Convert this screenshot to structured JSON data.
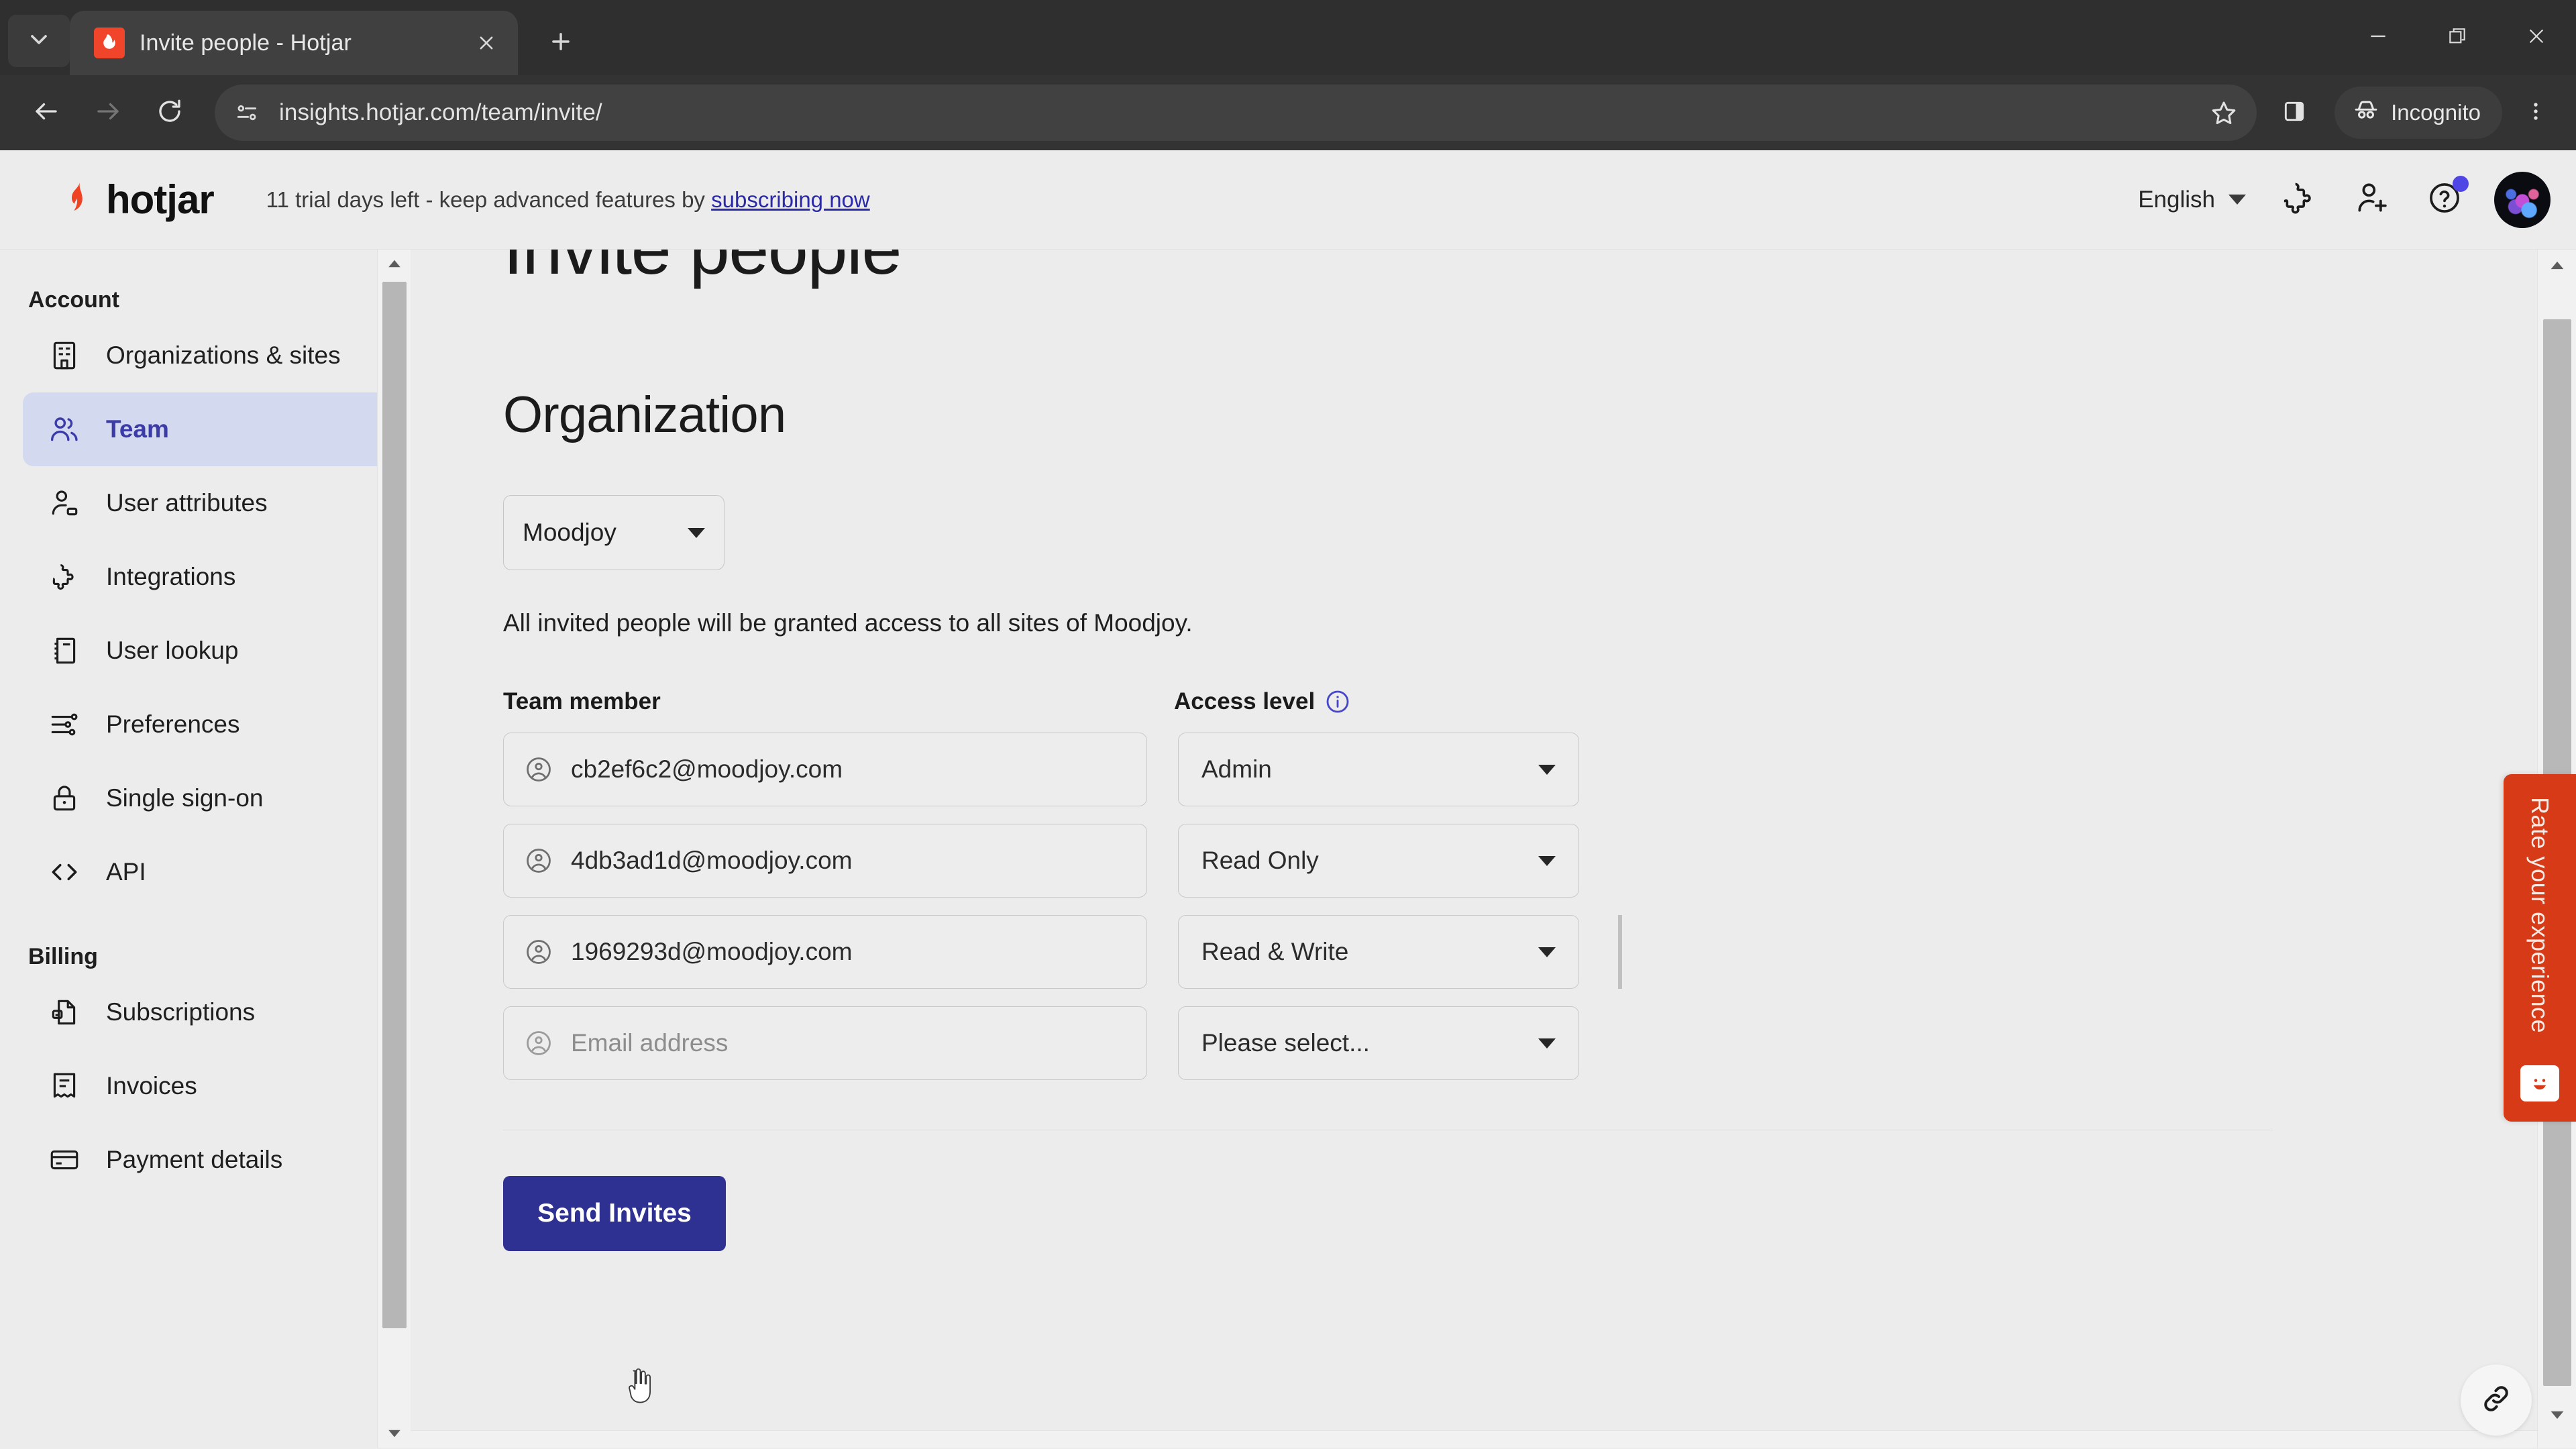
{
  "browser": {
    "tab": {
      "title": "Invite people - Hotjar",
      "favicon_icon": "hotjar-favicon",
      "close_icon": "close-icon"
    },
    "tab_list_icon": "chevron-down-icon",
    "new_tab_icon": "plus-icon",
    "window_controls": {
      "minimize_icon": "minimize-icon",
      "maximize_icon": "restore-icon",
      "close_icon": "close-icon"
    },
    "toolbar": {
      "back_icon": "arrow-left-icon",
      "forward_icon": "arrow-right-icon",
      "reload_icon": "reload-icon",
      "site_info_icon": "page-settings-icon",
      "url": "insights.hotjar.com/team/invite/",
      "bookmark_icon": "star-icon",
      "side_panel_icon": "side-panel-icon",
      "incognito_label": "Incognito",
      "incognito_icon": "incognito-icon",
      "menu_icon": "kebab-menu-icon"
    }
  },
  "app_header": {
    "logo_text": "hotjar",
    "logo_icon": "hotjar-flame-icon",
    "trial_prefix": "11 trial days left - keep advanced features by ",
    "trial_link": "subscribing now",
    "language": "English",
    "language_caret_icon": "chevron-down-icon",
    "integrations_icon": "puzzle-piece-icon",
    "invite_icon": "user-plus-icon",
    "help_icon": "question-circle-icon",
    "avatar_icon": "user-avatar"
  },
  "sidebar": {
    "groups": [
      {
        "title": "Account",
        "items": [
          {
            "label": "Organizations & sites",
            "icon": "building-icon",
            "active": false
          },
          {
            "label": "Team",
            "icon": "users-icon",
            "active": true
          },
          {
            "label": "User attributes",
            "icon": "user-tag-icon",
            "active": false
          },
          {
            "label": "Integrations",
            "icon": "puzzle-piece-icon",
            "active": false
          },
          {
            "label": "User lookup",
            "icon": "id-card-icon",
            "active": false
          },
          {
            "label": "Preferences",
            "icon": "sliders-icon",
            "active": false
          },
          {
            "label": "Single sign-on",
            "icon": "lock-icon",
            "active": false
          },
          {
            "label": "API",
            "icon": "code-brackets-icon",
            "active": false
          }
        ]
      },
      {
        "title": "Billing",
        "items": [
          {
            "label": "Subscriptions",
            "icon": "document-lock-icon",
            "active": false
          },
          {
            "label": "Invoices",
            "icon": "receipt-icon",
            "active": false
          },
          {
            "label": "Payment details",
            "icon": "credit-card-icon",
            "active": false
          }
        ]
      }
    ],
    "scroll_up_icon": "caret-up-icon",
    "scroll_down_icon": "caret-down-icon"
  },
  "main": {
    "page_title": "Invite people",
    "section_title": "Organization",
    "organization_select": {
      "value": "Moodjoy",
      "caret_icon": "caret-down-icon"
    },
    "note": "All invited people will be granted access to all sites of Moodjoy.",
    "columns": {
      "member": "Team member",
      "access": "Access level",
      "access_info_icon": "info-circle-icon"
    },
    "rows": [
      {
        "email": "cb2ef6c2@moodjoy.com",
        "is_placeholder": false,
        "access": "Admin",
        "user_icon": "user-circle-icon",
        "caret_icon": "caret-down-icon"
      },
      {
        "email": "4db3ad1d@moodjoy.com",
        "is_placeholder": false,
        "access": "Read Only",
        "user_icon": "user-circle-icon",
        "caret_icon": "caret-down-icon"
      },
      {
        "email": "1969293d@moodjoy.com",
        "is_placeholder": false,
        "access": "Read & Write",
        "user_icon": "user-circle-icon",
        "caret_icon": "caret-down-icon"
      },
      {
        "email": "Email address",
        "is_placeholder": true,
        "access": "Please select...",
        "user_icon": "user-circle-icon",
        "caret_icon": "caret-down-icon"
      }
    ],
    "submit_label": "Send Invites"
  },
  "widgets": {
    "rate_tab_label": "Rate your experience",
    "rate_tab_icon": "smiley-face-icon",
    "rate_tab_color": "#d63a17",
    "link_bubble_icon": "link-icon"
  },
  "colors": {
    "accent_blue": "#2e3192",
    "active_nav_bg": "#d3d9ef",
    "active_nav_text": "#3c3ca8",
    "hotjar_red": "#f0452a",
    "page_bg": "#ececec",
    "chrome_bg": "#333333"
  }
}
